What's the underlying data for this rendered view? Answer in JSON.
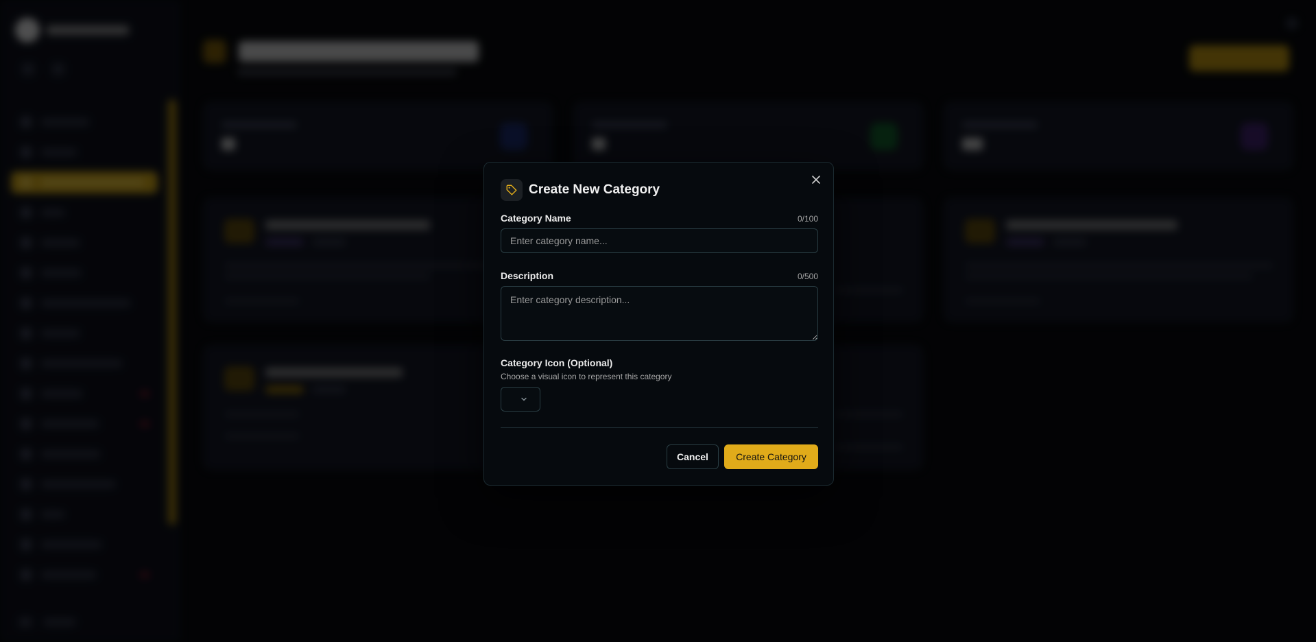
{
  "modal": {
    "title": "Create New Category",
    "name_field": {
      "label": "Category Name",
      "counter": "0/100",
      "placeholder": "Enter category name...",
      "value": ""
    },
    "description_field": {
      "label": "Description",
      "counter": "0/500",
      "placeholder": "Enter category description...",
      "value": ""
    },
    "icon_field": {
      "label": "Category Icon (Optional)",
      "hint": "Choose a visual icon to represent this category",
      "selected": ""
    },
    "cancel_label": "Cancel",
    "create_label": "Create Category"
  },
  "icons": {
    "close": "close-icon",
    "header": "tag-icon",
    "select": "chevron-down-icon"
  },
  "colors": {
    "accent": "#e0ab1a",
    "modal_bg": "#060a0e",
    "border": "#2a3e44"
  }
}
